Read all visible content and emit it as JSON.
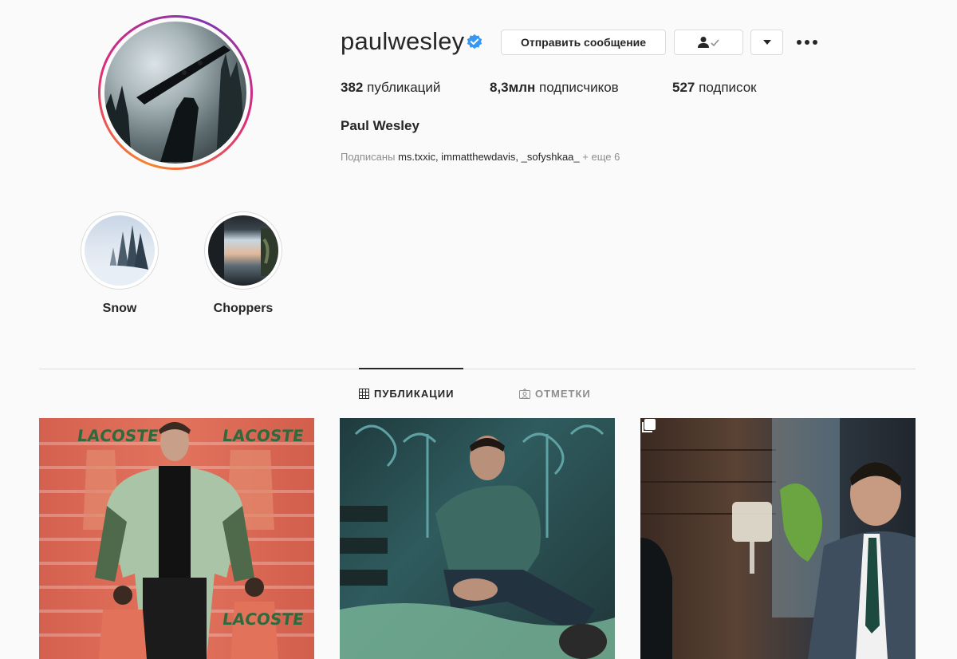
{
  "profile": {
    "username": "paulwesley",
    "verified": true,
    "full_name": "Paul Wesley",
    "stats": {
      "posts_num": "382",
      "posts_label": "публикаций",
      "followers_num": "8,3млн",
      "followers_label": "подписчиков",
      "following_num": "527",
      "following_label": "подписок"
    },
    "followed_by": {
      "prefix": "Подписаны",
      "names": "ms.txxic, immatthewdavis, _sofyshkaa_",
      "more": "+ еще 6"
    }
  },
  "actions": {
    "message_label": "Отправить сообщение",
    "following_icon": "person-check-icon",
    "dropdown_icon": "caret-down-icon",
    "more_icon": "more-dots-icon"
  },
  "highlights": [
    {
      "label": "Snow"
    },
    {
      "label": "Choppers"
    }
  ],
  "tabs": [
    {
      "label": "ПУБЛИКАЦИИ",
      "icon": "grid-icon",
      "active": true
    },
    {
      "label": "ОТМЕТКИ",
      "icon": "tagged-icon",
      "active": false
    }
  ],
  "posts": [
    {
      "brand_text": "LACOSTE",
      "multi": false
    },
    {
      "multi": false
    },
    {
      "multi": true,
      "icon": "carousel-icon"
    }
  ],
  "colors": {
    "accent": "#3897f0",
    "text": "#262626",
    "muted": "#8e8e8e",
    "border": "#dbdbdb",
    "background": "#fafafa"
  }
}
